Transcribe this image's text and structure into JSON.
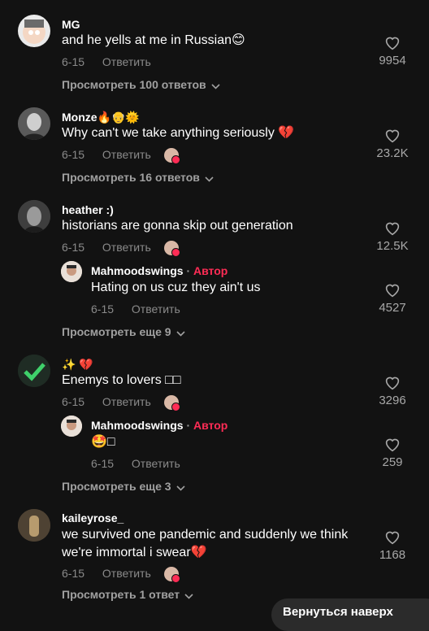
{
  "comments": [
    {
      "username": "MG",
      "text": "and he yells at me in Russian😊",
      "date": "6-15",
      "reply_label": "Ответить",
      "likes": "9954",
      "view_replies": "Просмотреть 100 ответов"
    },
    {
      "username": "Monze🔥👴🌞",
      "text": "Why can't we take anything seriously 💔",
      "date": "6-15",
      "reply_label": "Ответить",
      "likes": "23.2K",
      "view_replies": "Просмотреть 16 ответов"
    },
    {
      "username": "heather :)",
      "text": "historians are gonna skip out generation",
      "date": "6-15",
      "reply_label": "Ответить",
      "likes": "12.5K",
      "reply": {
        "username": "Mahmoodswings",
        "author_badge": "Автор",
        "text": "Hating on us cuz they ain't us",
        "date": "6-15",
        "reply_label": "Ответить",
        "likes": "4527"
      },
      "view_replies": "Просмотреть еще 9"
    },
    {
      "username": "✨ 💔",
      "text": "Enemys to lovers □□",
      "date": "6-15",
      "reply_label": "Ответить",
      "likes": "3296",
      "reply": {
        "username": "Mahmoodswings",
        "author_badge": "Автор",
        "text": "🤩□",
        "date": "6-15",
        "reply_label": "Ответить",
        "likes": "259"
      },
      "view_replies": "Просмотреть еще 3"
    },
    {
      "username": "kaileyrose_",
      "text_line1": "we survived one pandemic and suddenly we think",
      "text_line2": "we're immortal i swear💔",
      "date": "6-15",
      "reply_label": "Ответить",
      "likes": "1168",
      "view_replies": "Просмотреть 1 ответ"
    }
  ],
  "back_button_label": "Вернуться наверх",
  "colors": {
    "background": "#121212",
    "author_badge": "#fe2c55",
    "muted_text": "#8a8a8a"
  }
}
